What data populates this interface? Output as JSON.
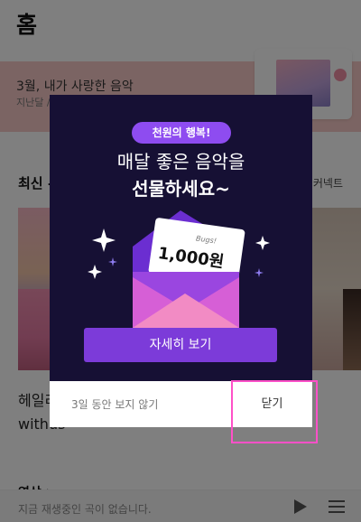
{
  "header": {
    "title": "홈"
  },
  "banner": {
    "title": "3월, 내가 사랑한 음악",
    "subtitle": "지난달 / 내가 사랑한 음악"
  },
  "sections": {
    "latest_label": "최신 —",
    "concert_label": "커넥트"
  },
  "list": {
    "artist_line_1": "헤일리",
    "artist_line_2": "withus"
  },
  "video": {
    "label": "영상 >"
  },
  "player": {
    "empty_text": "지금 재생중인 곡이 없습니다."
  },
  "popup": {
    "pill": "천원의 행복!",
    "headline_line_1": "매달 좋은 음악을",
    "headline_line_2": "선물하세요~",
    "card_brand": "Bugs!",
    "card_amount": "1,000원",
    "detail_button": "자세히 보기",
    "hide_3days": "3일 동안 보지 않기",
    "close_button": "닫기"
  },
  "colors": {
    "modal_bg": "#161034",
    "accent_purple": "#7c3bd9",
    "pill_purple": "#8e4cf0",
    "highlight_pink": "#ff50c8"
  },
  "icons": {
    "play": "play-icon",
    "playlist": "playlist-icon"
  }
}
